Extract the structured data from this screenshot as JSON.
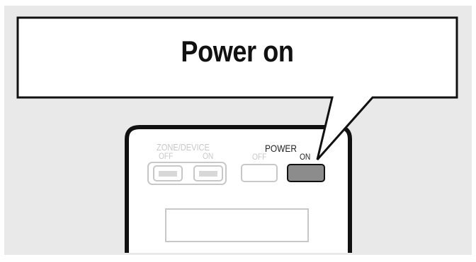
{
  "callout": {
    "title": "Power on"
  },
  "remote": {
    "zone_device": {
      "label": "ZONE/DEVICE",
      "off_label": "OFF",
      "on_label": "ON"
    },
    "power": {
      "label": "POWER",
      "off_label": "OFF",
      "on_label": "ON",
      "highlighted_button": "ON"
    }
  },
  "colors": {
    "background": "#e9e9e9",
    "outline": "#111111",
    "highlight_fill": "#8c8c8c",
    "faint": "#c8c8c8"
  }
}
